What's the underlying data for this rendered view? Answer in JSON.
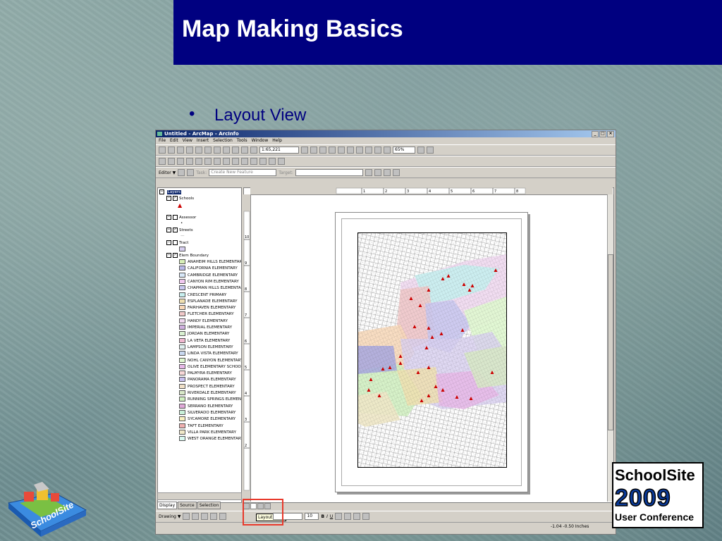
{
  "slide": {
    "title": "Map Making Basics",
    "bullet": "Layout View"
  },
  "window": {
    "title": "Untitled - ArcMap - ArcInfo",
    "controls": [
      "_",
      "□",
      "×"
    ],
    "menus": [
      "File",
      "Edit",
      "View",
      "Insert",
      "Selection",
      "Tools",
      "Window",
      "Help"
    ],
    "scale": "1:65,221",
    "zoom": "65%",
    "editor_label": "Editor ▼",
    "task_label": "Task:",
    "task_value": "Create New Feature",
    "target_label": "Target:",
    "target_value": ""
  },
  "toc": {
    "tabs": [
      "Display",
      "Source",
      "Selection"
    ],
    "active_tab": "Display",
    "layers_title": "Layers",
    "groups": [
      {
        "name": "Schools",
        "checked": true
      },
      {
        "name": "Assessor",
        "checked": false
      },
      {
        "name": "Streets",
        "checked": true
      },
      {
        "name": "Tract",
        "checked": false
      },
      {
        "name": "Elem Boundary",
        "checked": true
      }
    ],
    "legend_items": [
      {
        "label": "ANAHEIM HILLS ELEMENTARY",
        "color": "#d8f0b8"
      },
      {
        "label": "CALIFORNIA ELEMENTARY",
        "color": "#b8b8e8"
      },
      {
        "label": "CAMBRIDGE ELEMENTARY",
        "color": "#d8e8f8"
      },
      {
        "label": "CANYON RIM ELEMENTARY",
        "color": "#f0c8f0"
      },
      {
        "label": "CHAPMAN HILLS ELEMENTARY",
        "color": "#c8c8f0"
      },
      {
        "label": "CRESCENT PRIMARY",
        "color": "#c8f0f0"
      },
      {
        "label": "ESPLANADE ELEMENTARY",
        "color": "#f0e0b0"
      },
      {
        "label": "FAIRHAVEN ELEMENTARY",
        "color": "#f8d8b8"
      },
      {
        "label": "FLETCHER ELEMENTARY",
        "color": "#f0c8c8"
      },
      {
        "label": "HANDY ELEMENTARY",
        "color": "#f0d8f0"
      },
      {
        "label": "IMPERIAL ELEMENTARY",
        "color": "#d0b0e0"
      },
      {
        "label": "JORDAN ELEMENTARY",
        "color": "#d8f0d0"
      },
      {
        "label": "LA VETA ELEMENTARY",
        "color": "#f0b8d0"
      },
      {
        "label": "LAMPSON ELEMENTARY",
        "color": "#e0f0f0"
      },
      {
        "label": "LINDA VISTA ELEMENTARY",
        "color": "#c8d8f0"
      },
      {
        "label": "NOHL CANYON ELEMENTARY",
        "color": "#e0f8d0"
      },
      {
        "label": "OLIVE ELEMENTARY SCHOOL",
        "color": "#e8b8e8"
      },
      {
        "label": "PALMYRA ELEMENTARY",
        "color": "#f8d8d8"
      },
      {
        "label": "PANORAMA ELEMENTARY",
        "color": "#c8c0f0"
      },
      {
        "label": "PROSPECT ELEMENTARY",
        "color": "#f0e0c8"
      },
      {
        "label": "RIVERDALE ELEMENTARY",
        "color": "#d8e8c8"
      },
      {
        "label": "RUNNING SPRINGS ELEMENTAR",
        "color": "#d0f0c0"
      },
      {
        "label": "SERRANO ELEMENTARY",
        "color": "#e0a8d8"
      },
      {
        "label": "SILVERADO ELEMENTARY",
        "color": "#c8f0d8"
      },
      {
        "label": "SYCAMORE ELEMENTARY",
        "color": "#f8f0c0"
      },
      {
        "label": "TAFT ELEMENTARY",
        "color": "#f0b0b0"
      },
      {
        "label": "VILLA PARK ELEMENTARY",
        "color": "#f0e8c8"
      },
      {
        "label": "WEST ORANGE ELEMENTARY",
        "color": "#d8f8f0"
      }
    ]
  },
  "ruler": {
    "h_ticks": [
      "1",
      "2",
      "3",
      "4",
      "5",
      "6",
      "7",
      "8"
    ],
    "v_ticks": [
      "10",
      "9",
      "8",
      "7",
      "6",
      "5",
      "4",
      "3",
      "2"
    ]
  },
  "drawing": {
    "label": "Drawing ▼",
    "font": "",
    "size": "10",
    "bold": "B",
    "italic": "I",
    "underline": "U"
  },
  "tooltip": "Layout View",
  "status": {
    "coords": "-1.04  -0.50 Inches"
  },
  "logos": {
    "left": "SchoolSite",
    "right_line1": "SchoolSite",
    "right_year": "2009",
    "right_line3": "User Conference"
  },
  "colors": {
    "title_bg": "#000080",
    "bullet": "#000080",
    "highlight": "#e8392b",
    "school_marker": "#cc0000"
  }
}
